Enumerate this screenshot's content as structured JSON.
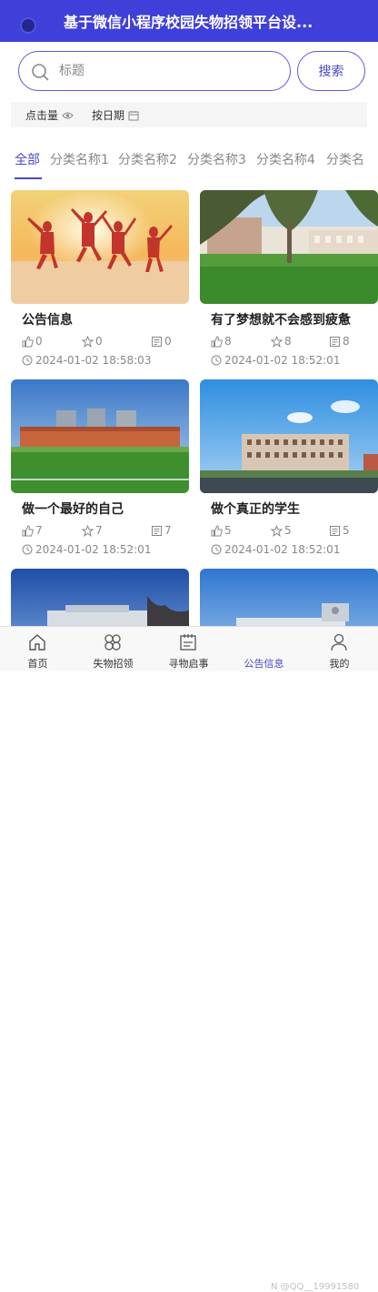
{
  "header": {
    "title": "基于微信小程序校园失物招领平台设..."
  },
  "search": {
    "placeholder": "标题",
    "button_label": "搜索"
  },
  "sort": {
    "clicks_label": "点击量",
    "date_label": "按日期"
  },
  "tabs": [
    "全部",
    "分类名称1",
    "分类名称2",
    "分类名称3",
    "分类名称4",
    "分类名"
  ],
  "active_tab": 0,
  "cards": [
    {
      "title": "公告信息",
      "likes": "0",
      "favorites": "0",
      "comments": "0",
      "date": "2024-01-02 18:58:03",
      "image": "jumping-people-sunset"
    },
    {
      "title": "有了梦想就不会感到疲惫",
      "likes": "8",
      "favorites": "8",
      "comments": "8",
      "date": "2024-01-02 18:52:01",
      "image": "campus-lawn-trees"
    },
    {
      "title": "做一个最好的自己",
      "likes": "7",
      "favorites": "7",
      "comments": "7",
      "date": "2024-01-02 18:52:01",
      "image": "campus-field-buildings"
    },
    {
      "title": "做个真正的学生",
      "likes": "5",
      "favorites": "5",
      "comments": "5",
      "date": "2024-01-02 18:52:01",
      "image": "campus-building-blue-sky"
    }
  ],
  "tabbar": [
    {
      "label": "首页",
      "icon": "home-icon"
    },
    {
      "label": "失物招领",
      "icon": "grid-flower-icon"
    },
    {
      "label": "寻物启事",
      "icon": "notebook-icon"
    },
    {
      "label": "公告信息",
      "icon": "notice-icon"
    },
    {
      "label": "我的",
      "icon": "user-icon"
    }
  ],
  "active_tabbar": 3,
  "watermark": "N @QQ__19991580"
}
